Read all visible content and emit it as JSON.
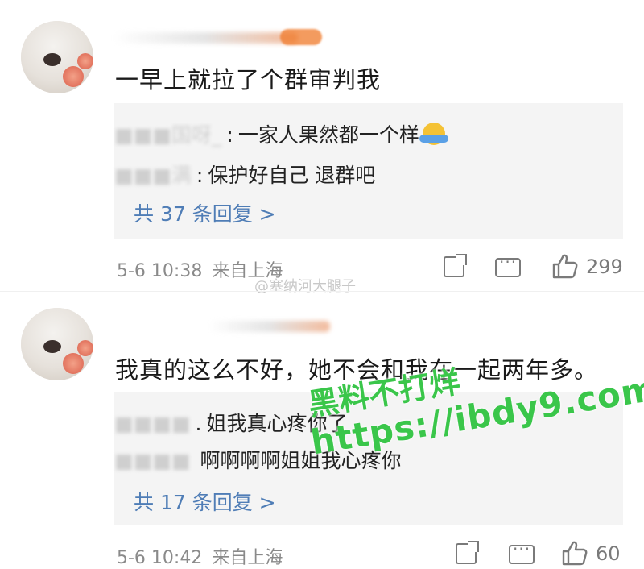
{
  "comments": [
    {
      "text": "一早上就拉了个群审判我",
      "replies": [
        {
          "name": "■■■国呀_",
          "sep": ":",
          "text": "一家人果然都一个样"
        },
        {
          "name": "■■■满",
          "sep": ":",
          "text": "保护好自己 退群吧"
        }
      ],
      "more_replies": "共 37 条回复 >",
      "time": "5-6 10:38",
      "location": "来自上海",
      "like_count": "299"
    },
    {
      "text": "我真的这么不好，她不会和我在一起两年多。",
      "replies": [
        {
          "name": "■■■■",
          "sep": ".",
          "text": "姐我真心疼你了"
        },
        {
          "name": "■■■■",
          "sep": "",
          "text": "啊啊啊啊姐姐我心疼你"
        }
      ],
      "more_replies": "共 17 条回复 >",
      "time": "5-6 10:42",
      "location": "来自上海",
      "like_count": "60"
    }
  ],
  "watermarks": {
    "weibo": "@塞纳河大腿子",
    "overlay_line1": "黑料不打烊",
    "overlay_line2": "https://ibdy9.com"
  },
  "icons": [
    "share-icon",
    "comment-icon",
    "like-icon"
  ],
  "colors": {
    "link": "#4f7db6",
    "reply_bg": "#f4f4f4",
    "meta": "#8a8a8a",
    "watermark_green": "#3ac64a"
  }
}
